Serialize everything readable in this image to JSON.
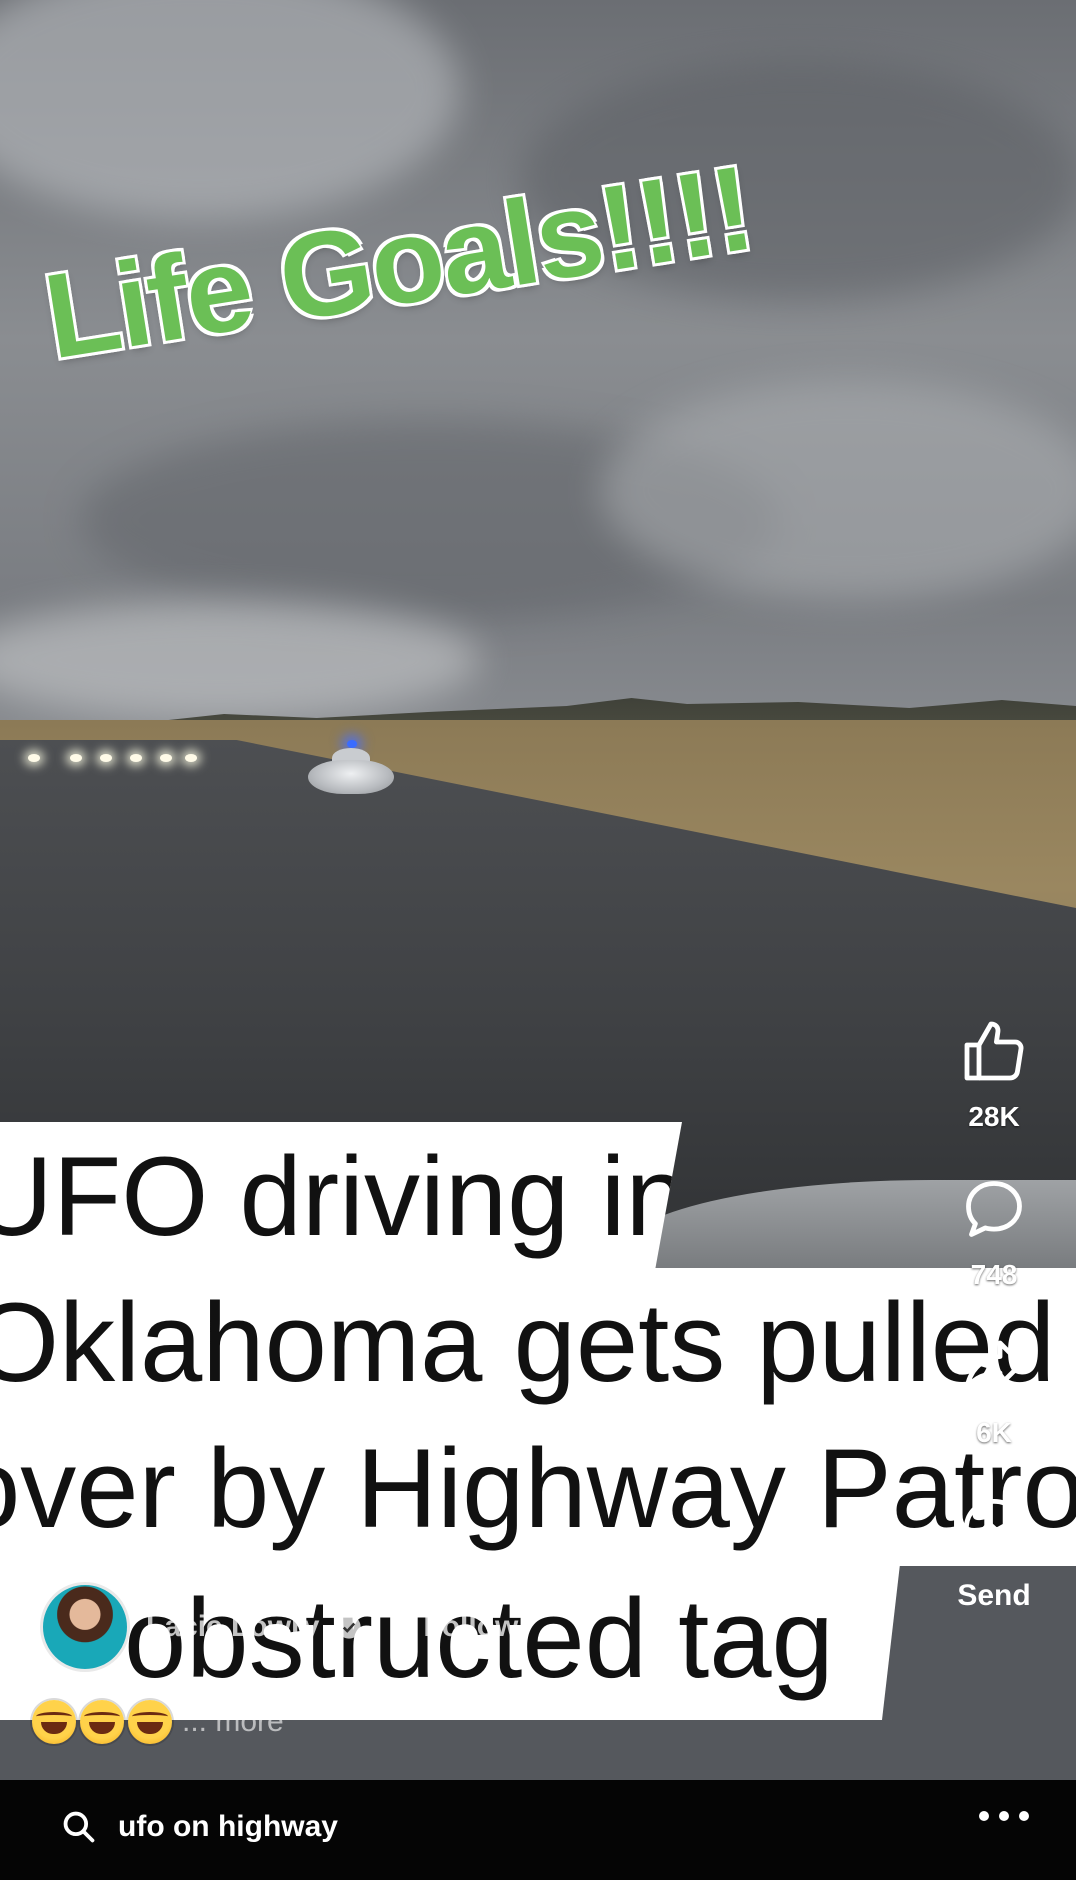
{
  "overlay": {
    "headline": "Life Goals!!!!",
    "caption_lines": [
      "UFO driving in",
      "Oklahoma gets pulled",
      "over by Highway Patrol",
      "obstructed tag"
    ]
  },
  "actions": {
    "like_count": "28K",
    "comment_count": "748",
    "share_count": "6K",
    "send_label": "Send"
  },
  "author": {
    "name": "Lacie Lowry",
    "follow_label": "Follow"
  },
  "description": {
    "more_label": "... more"
  },
  "search": {
    "query": "ufo on highway"
  },
  "colors": {
    "headline_green": "#6bbf56",
    "caption_bg": "#ffffff",
    "bottom_bar": "#050505"
  }
}
